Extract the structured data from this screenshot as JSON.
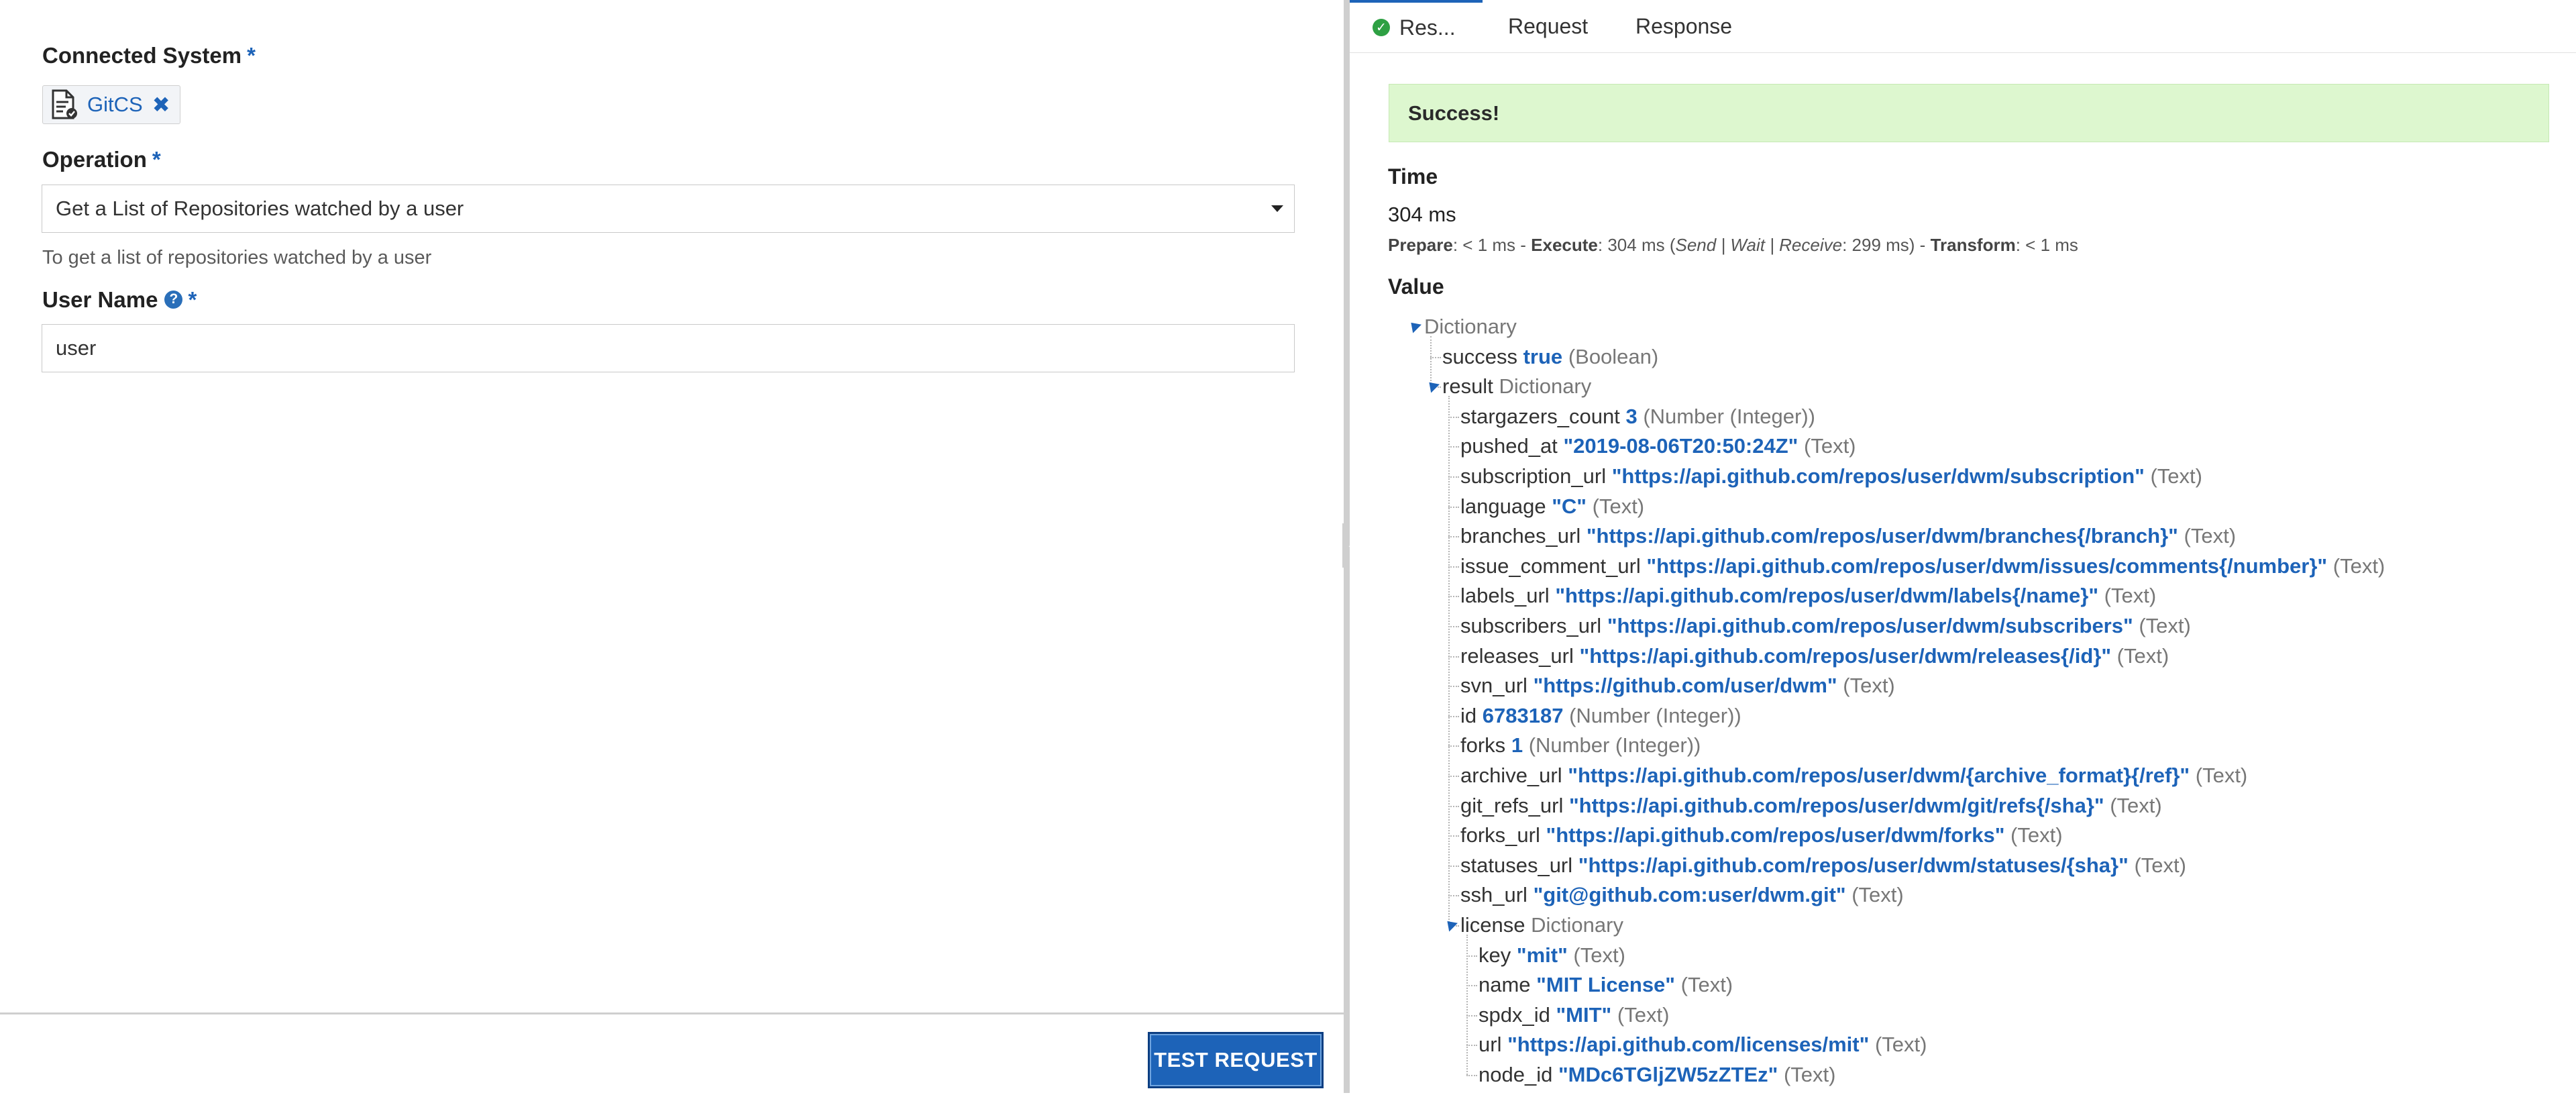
{
  "left": {
    "connected_system_label": "Connected System",
    "required_mark": "*",
    "chip_name": "GitCS",
    "operation_label": "Operation",
    "operation_value": "Get a List of Repositories watched by a user",
    "operation_help": "To get a list of repositories watched by a user",
    "username_label": "User Name",
    "username_value": "user",
    "test_button": "TEST REQUEST"
  },
  "right": {
    "tabs": [
      {
        "label": "Res..."
      },
      {
        "label": "Request"
      },
      {
        "label": "Response"
      }
    ],
    "success_text": "Success!",
    "time_label": "Time",
    "time_total": "304 ms",
    "time_detail": {
      "prepare_label": "Prepare",
      "prepare_val": ": < 1 ms - ",
      "execute_label": "Execute",
      "execute_val": ": 304 ms (",
      "swr": "Send | Wait | Receive",
      "swr_val": ": 299 ms) - ",
      "transform_label": "Transform",
      "transform_val": ": < 1 ms"
    },
    "value_label": "Value",
    "tree": [
      {
        "level": 0,
        "expanded": true,
        "key": "Dictionary",
        "type_only": true
      },
      {
        "level": 1,
        "key": "success",
        "value": "true",
        "type": "(Boolean)"
      },
      {
        "level": 1,
        "expanded": true,
        "key": "result",
        "typename": "Dictionary"
      },
      {
        "level": 2,
        "key": "stargazers_count",
        "value": "3",
        "type": "(Number (Integer))"
      },
      {
        "level": 2,
        "key": "pushed_at",
        "value": "\"2019-08-06T20:50:24Z\"",
        "type": "(Text)"
      },
      {
        "level": 2,
        "key": "subscription_url",
        "value": "\"https://api.github.com/repos/user/dwm/subscription\"",
        "type": "(Text)"
      },
      {
        "level": 2,
        "key": "language",
        "value": "\"C\"",
        "type": "(Text)"
      },
      {
        "level": 2,
        "key": "branches_url",
        "value": "\"https://api.github.com/repos/user/dwm/branches{/branch}\"",
        "type": "(Text)"
      },
      {
        "level": 2,
        "key": "issue_comment_url",
        "value": "\"https://api.github.com/repos/user/dwm/issues/comments{/number}\"",
        "type": "(Text)"
      },
      {
        "level": 2,
        "key": "labels_url",
        "value": "\"https://api.github.com/repos/user/dwm/labels{/name}\"",
        "type": "(Text)"
      },
      {
        "level": 2,
        "key": "subscribers_url",
        "value": "\"https://api.github.com/repos/user/dwm/subscribers\"",
        "type": "(Text)"
      },
      {
        "level": 2,
        "key": "releases_url",
        "value": "\"https://api.github.com/repos/user/dwm/releases{/id}\"",
        "type": "(Text)"
      },
      {
        "level": 2,
        "key": "svn_url",
        "value": "\"https://github.com/user/dwm\"",
        "type": "(Text)"
      },
      {
        "level": 2,
        "key": "id",
        "value": "6783187",
        "type": "(Number (Integer))"
      },
      {
        "level": 2,
        "key": "forks",
        "value": "1",
        "type": "(Number (Integer))"
      },
      {
        "level": 2,
        "key": "archive_url",
        "value": "\"https://api.github.com/repos/user/dwm/{archive_format}{/ref}\"",
        "type": "(Text)"
      },
      {
        "level": 2,
        "key": "git_refs_url",
        "value": "\"https://api.github.com/repos/user/dwm/git/refs{/sha}\"",
        "type": "(Text)"
      },
      {
        "level": 2,
        "key": "forks_url",
        "value": "\"https://api.github.com/repos/user/dwm/forks\"",
        "type": "(Text)"
      },
      {
        "level": 2,
        "key": "statuses_url",
        "value": "\"https://api.github.com/repos/user/dwm/statuses/{sha}\"",
        "type": "(Text)"
      },
      {
        "level": 2,
        "key": "ssh_url",
        "value": "\"git@github.com:user/dwm.git\"",
        "type": "(Text)"
      },
      {
        "level": 2,
        "expanded": true,
        "key": "license",
        "typename": "Dictionary"
      },
      {
        "level": 3,
        "key": "key",
        "value": "\"mit\"",
        "type": "(Text)"
      },
      {
        "level": 3,
        "key": "name",
        "value": "\"MIT License\"",
        "type": "(Text)"
      },
      {
        "level": 3,
        "key": "spdx_id",
        "value": "\"MIT\"",
        "type": "(Text)"
      },
      {
        "level": 3,
        "key": "url",
        "value": "\"https://api.github.com/licenses/mit\"",
        "type": "(Text)"
      },
      {
        "level": 3,
        "key": "node_id",
        "value": "\"MDc6TGljZW5zZTEz\"",
        "type": "(Text)"
      }
    ]
  }
}
